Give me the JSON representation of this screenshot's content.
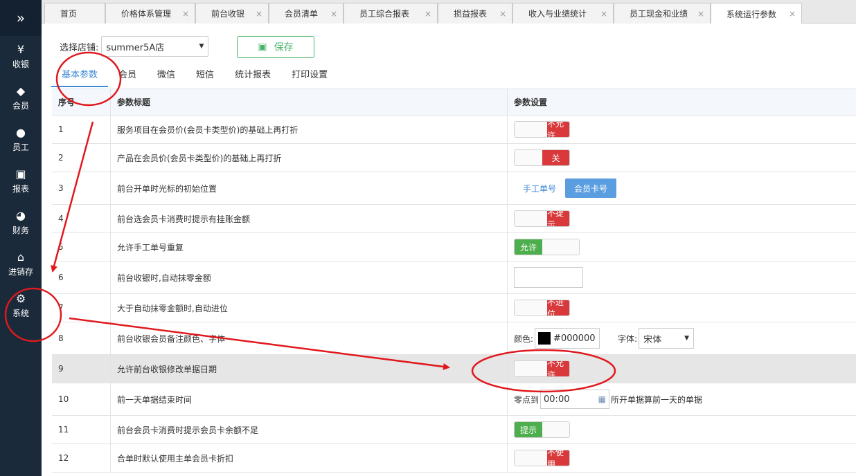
{
  "sidebar": {
    "toggle_glyph": "»",
    "items": [
      {
        "label": "收银",
        "icon": "cash-icon",
        "glyph": "¥"
      },
      {
        "label": "会员",
        "icon": "diamond-icon",
        "glyph": "◆"
      },
      {
        "label": "员工",
        "icon": "user-icon",
        "glyph": "●"
      },
      {
        "label": "报表",
        "icon": "monitor-icon",
        "glyph": "▣"
      },
      {
        "label": "财务",
        "icon": "pie-chart-icon",
        "glyph": "◕"
      },
      {
        "label": "进销存",
        "icon": "home-icon",
        "glyph": "⌂"
      },
      {
        "label": "系统",
        "icon": "gear-icon",
        "glyph": "⚙"
      }
    ]
  },
  "tabs": [
    {
      "label": "首页"
    },
    {
      "label": "价格体系管理"
    },
    {
      "label": "前台收银"
    },
    {
      "label": "会员清单"
    },
    {
      "label": "员工综合报表"
    },
    {
      "label": "损益报表"
    },
    {
      "label": "收入与业绩统计"
    },
    {
      "label": "员工现金和业绩"
    },
    {
      "label": "系统运行参数"
    }
  ],
  "close_glyph": "×",
  "store": {
    "label": "选择店铺:",
    "value": "summer5A店",
    "caret": "▼"
  },
  "save_button": {
    "label": "保存",
    "icon": "save-icon",
    "glyph": "▣"
  },
  "subtabs": [
    "基本参数",
    "会员",
    "微信",
    "短信",
    "统计报表",
    "打印设置"
  ],
  "table": {
    "headers": [
      "序号",
      "参数标题",
      "参数设置"
    ],
    "rows": [
      {
        "no": "1",
        "title": "服务项目在会员价(会员卡类型价)的基础上再打折",
        "setting": "不允许"
      },
      {
        "no": "2",
        "title": "产品在会员价(会员卡类型价)的基础上再打折",
        "setting": "关"
      },
      {
        "no": "3",
        "title": "前台开单时光标的初始位置",
        "options": [
          "手工单号",
          "会员卡号"
        ]
      },
      {
        "no": "4",
        "title": "前台选会员卡消费时提示有挂账金额",
        "setting": "不提示"
      },
      {
        "no": "5",
        "title": "允许手工单号重复",
        "setting": "允许"
      },
      {
        "no": "6",
        "title": "前台收银时,自动抹零金额",
        "setting": ""
      },
      {
        "no": "7",
        "title": "大于自动抹零金额时,自动进位",
        "setting": "不进位"
      },
      {
        "no": "8",
        "title": "前台收银会员备注颜色、字体",
        "color_label": "颜色:",
        "color_value": "#000000",
        "font_label": "字体:",
        "font_value": "宋体"
      },
      {
        "no": "9",
        "title": "允许前台收银修改单据日期",
        "setting": "不允许"
      },
      {
        "no": "10",
        "title": "前一天单据结束时间",
        "prefix": "零点到",
        "time": "00:00",
        "suffix": "所开单据算前一天的单据"
      },
      {
        "no": "11",
        "title": "前台会员卡消费时提示会员卡余额不足",
        "setting": "提示"
      },
      {
        "no": "12",
        "title": "合单时默认使用主单会员卡折扣",
        "setting": "不使用"
      }
    ]
  },
  "colors": {
    "sidebar": "#1b2a3a",
    "accent": "#3d8ad8",
    "red": "#d9393b",
    "green": "#4cae4c",
    "annotation": "#e0191e"
  }
}
